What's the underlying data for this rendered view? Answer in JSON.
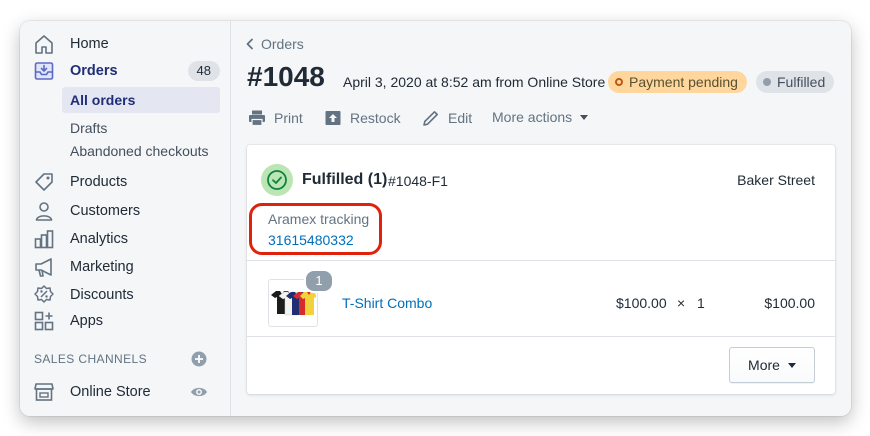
{
  "sidebar": {
    "items": [
      {
        "label": "Home",
        "icon": "home-icon"
      },
      {
        "label": "Orders",
        "icon": "orders-icon",
        "count": "48"
      },
      {
        "label": "Products",
        "icon": "tag-icon"
      },
      {
        "label": "Customers",
        "icon": "person-icon"
      },
      {
        "label": "Analytics",
        "icon": "bar-chart-icon"
      },
      {
        "label": "Marketing",
        "icon": "megaphone-icon"
      },
      {
        "label": "Discounts",
        "icon": "discount-badge-icon"
      },
      {
        "label": "Apps",
        "icon": "apps-grid-icon"
      }
    ],
    "orders_subitems": [
      "All orders",
      "Drafts",
      "Abandoned checkouts"
    ],
    "sales_channels_heading": "SALES CHANNELS",
    "online_store_label": "Online Store"
  },
  "header": {
    "breadcrumb": "Orders",
    "order_number": "#1048",
    "order_meta": "April 3, 2020 at 8:52 am from Online Store",
    "payment_status": "Payment pending",
    "fulfillment_status": "Fulfilled"
  },
  "actions": {
    "print": "Print",
    "restock": "Restock",
    "edit": "Edit",
    "more_actions": "More actions"
  },
  "fulfillment_card": {
    "title": "Fulfilled (1)",
    "fulfillment_id": "#1048-F1",
    "location": "Baker Street",
    "tracking_label": "Aramex tracking",
    "tracking_number": "31615480332",
    "line_item": {
      "quantity_badge": "1",
      "name": "T-Shirt Combo",
      "unit_price": "$100.00",
      "times": "×",
      "quantity": "1",
      "total": "$100.00"
    },
    "more_button": "More"
  },
  "colors": {
    "accent_link": "#006fbb",
    "highlight_ring": "#e0220c",
    "payment_pending_bg": "#ffd79d",
    "fulfilled_icon_bg": "#bbe5b3"
  }
}
